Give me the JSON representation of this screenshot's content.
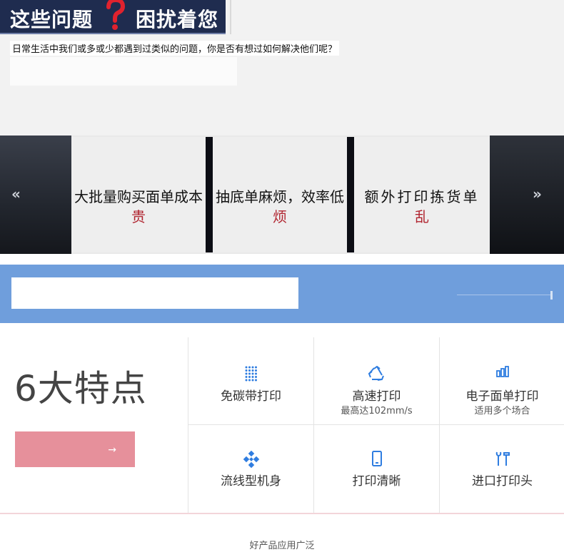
{
  "header": {
    "title_left": "这些问题",
    "title_right": "困扰着您",
    "intro": "日常生活中我们或多或少都遇到过类似的问题，你是否有想过如何解决他们呢？"
  },
  "problems": {
    "prev_arrow": "«",
    "next_arrow": "»",
    "cards": [
      {
        "title": "大批量购买面单成本",
        "sub": "贵"
      },
      {
        "title": "抽底单麻烦，效率低",
        "sub": "烦"
      },
      {
        "title": "额外打印拣货单",
        "sub": "乱"
      }
    ]
  },
  "features": {
    "title": "6大特点",
    "button_arrow": "→",
    "items": [
      {
        "name": "免碳带打印",
        "sub": "",
        "icon": "dot-grid-icon"
      },
      {
        "name": "高速打印",
        "sub": "最高达102mm/s",
        "icon": "recycle-icon"
      },
      {
        "name": "电子面单打印",
        "sub": "适用多个场合",
        "icon": "bar-chart-icon"
      },
      {
        "name": "流线型机身",
        "sub": "",
        "icon": "diamond-cluster-icon"
      },
      {
        "name": "打印清晰",
        "sub": "",
        "icon": "phone-outline-icon"
      },
      {
        "name": "进口打印头",
        "sub": "",
        "icon": "tools-icon"
      }
    ]
  },
  "footer": {
    "text": "好产品应用广泛"
  },
  "colors": {
    "banner_bg": "#1f2c4f",
    "accent_red": "#b0242f",
    "blue_band": "#6f9edc",
    "feature_icon": "#2f7de0",
    "button_pink": "#e6909b"
  }
}
